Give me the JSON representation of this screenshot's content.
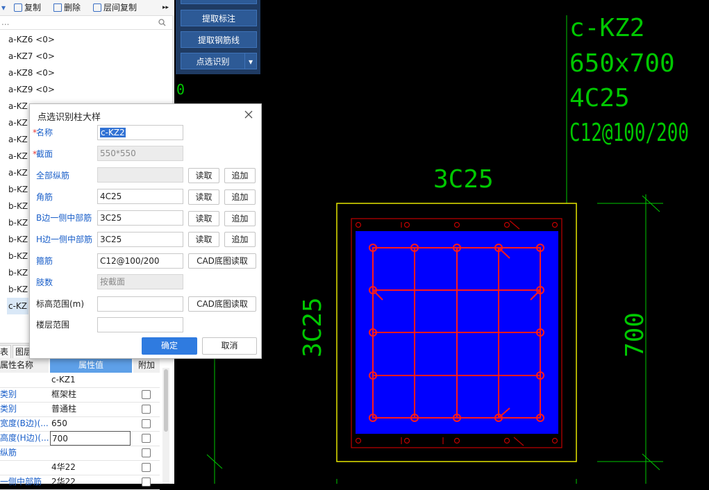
{
  "toolbar": {
    "copy_label": "复制",
    "delete_label": "删除",
    "floor_copy_label": "层间复制",
    "more_glyph": "▸▸"
  },
  "search": {
    "placeholder": "..."
  },
  "tree": {
    "items": [
      {
        "label": "a-KZ6 <0>"
      },
      {
        "label": "a-KZ7 <0>"
      },
      {
        "label": "a-KZ8 <0>"
      },
      {
        "label": "a-KZ9 <0>"
      },
      {
        "label": "a-KZ"
      },
      {
        "label": "a-KZ"
      },
      {
        "label": "a-KZ"
      },
      {
        "label": "a-KZ"
      },
      {
        "label": "a-KZ"
      },
      {
        "label": "b-KZ"
      },
      {
        "label": "b-KZ"
      },
      {
        "label": "b-KZ"
      },
      {
        "label": "b-KZ"
      },
      {
        "label": "b-KZ"
      },
      {
        "label": "b-KZ"
      },
      {
        "label": "b-KZ"
      },
      {
        "label": "c-KZ"
      }
    ]
  },
  "props": {
    "tabs": [
      "表",
      "图层"
    ],
    "headers": {
      "name": "属性名称",
      "value": "属性值",
      "extra": "附加"
    },
    "rows": [
      {
        "name": "",
        "value": "c-KZ1",
        "has_check": false
      },
      {
        "name": "类别",
        "value": "框架柱",
        "has_check": true
      },
      {
        "name": "类别",
        "value": "普通柱",
        "has_check": true
      },
      {
        "name": "宽度(B边)(...",
        "value": "650",
        "has_check": true
      },
      {
        "name": "高度(H边)(...",
        "value": "700",
        "has_check": true
      },
      {
        "name": "纵筋",
        "value": "",
        "has_check": true
      },
      {
        "name": "",
        "value": "4华22",
        "has_check": true
      },
      {
        "name": "一侧中部筋",
        "value": "2华22",
        "has_check": true
      }
    ]
  },
  "ribbon": {
    "btn1": "提取标注",
    "btn2": "提取钢筋线",
    "btn3": "点选识别",
    "dropdown_glyph": "▾"
  },
  "dialog": {
    "title": "点选识别柱大样",
    "fields": {
      "name": {
        "label": "名称",
        "value": "c-KZ2"
      },
      "section": {
        "label": "截面",
        "value": "550*550"
      },
      "all_long": {
        "label": "全部纵筋",
        "value": ""
      },
      "corner": {
        "label": "角筋",
        "value": "4C25"
      },
      "b_mid": {
        "label": "B边一侧中部筋",
        "value": "3C25"
      },
      "h_mid": {
        "label": "H边一侧中部筋",
        "value": "3C25"
      },
      "stirrup": {
        "label": "箍筋",
        "value": "C12@100/200"
      },
      "legs": {
        "label": "肢数",
        "value": "按截面"
      },
      "elev": {
        "label": "标高范围(m)",
        "value": ""
      },
      "floor": {
        "label": "楼层范围",
        "value": ""
      }
    },
    "read_label": "读取",
    "add_label": "追加",
    "cad_read_label": "CAD底图读取",
    "ok_label": "确定",
    "cancel_label": "取消",
    "required_mark": "*"
  },
  "cad": {
    "name": "c-KZ2",
    "size": "650x700",
    "corner": "4C25",
    "stirrup": "C12@100/200",
    "top_bars": "3C25",
    "side_bars": "3C25",
    "dim_h": "700",
    "left_clip": "0",
    "colors": {
      "text": "#00c800",
      "rebar": "#ff1a1a",
      "fill": "#0000ff",
      "outline": "#e6e600",
      "dark_red": "#c00000"
    }
  }
}
